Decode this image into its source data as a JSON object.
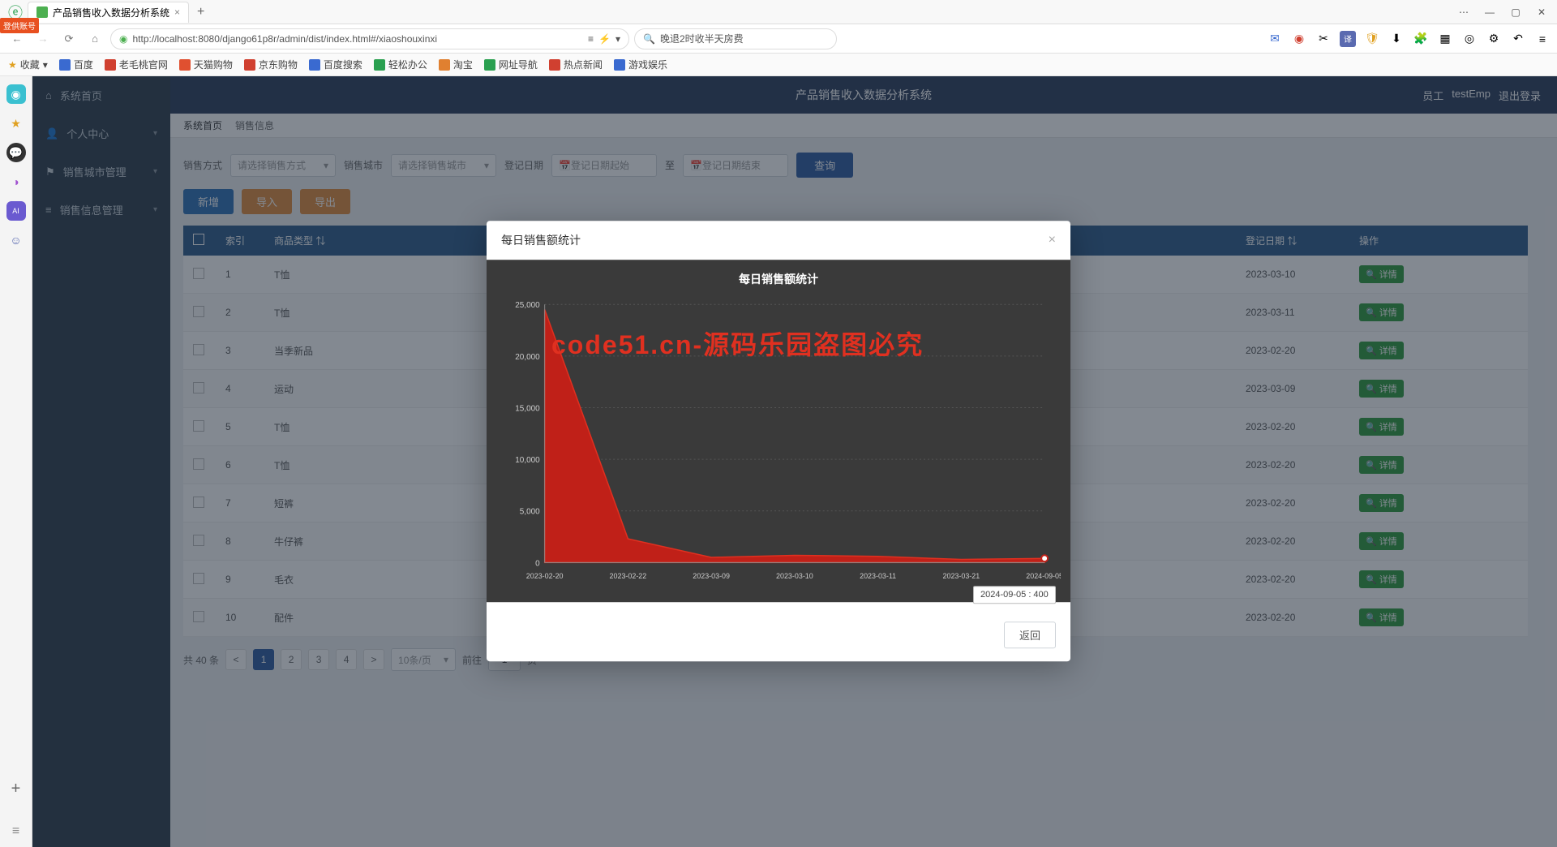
{
  "browser": {
    "tab_title": "产品销售收入数据分析系统",
    "url": "http://localhost:8080/django61p8r/admin/dist/index.html#/xiaoshouxinxi",
    "search_placeholder": "晚退2时收半天房费",
    "login_badge": "登供账号",
    "bookmarks": [
      "收藏",
      "百度",
      "老毛桃官网",
      "天猫购物",
      "京东购物",
      "百度搜索",
      "轻松办公",
      "淘宝",
      "网址导航",
      "热点新闻",
      "游戏娱乐"
    ]
  },
  "app": {
    "title": "产品销售收入数据分析系统",
    "user_role": "员工",
    "user_name": "testEmp",
    "logout": "退出登录",
    "menu": [
      "系统首页",
      "个人中心",
      "销售城市管理",
      "销售信息管理"
    ],
    "crumb_home": "系统首页",
    "crumb_page": "销售信息"
  },
  "filter": {
    "label_type": "销售方式",
    "ph_type": "请选择销售方式",
    "label_city": "销售城市",
    "ph_city": "请选择销售城市",
    "label_date": "登记日期",
    "ph_date_start": "登记日期起始",
    "to": "至",
    "ph_date_end": "登记日期结束",
    "btn_search": "查询"
  },
  "buttons": {
    "add": "新增",
    "import": "导入",
    "export": "导出"
  },
  "table": {
    "headers": [
      "",
      "索引",
      "商品类型",
      "",
      "登记日期",
      "操作"
    ],
    "detail": "详情",
    "rows": [
      {
        "idx": "1",
        "type": "T恤",
        "date": "2023-03-10"
      },
      {
        "idx": "2",
        "type": "T恤",
        "date": "2023-03-11"
      },
      {
        "idx": "3",
        "type": "当季新品",
        "date": "2023-02-20"
      },
      {
        "idx": "4",
        "type": "运动",
        "date": "2023-03-09"
      },
      {
        "idx": "5",
        "type": "T恤",
        "date": "2023-02-20"
      },
      {
        "idx": "6",
        "type": "T恤",
        "date": "2023-02-20"
      },
      {
        "idx": "7",
        "type": "短裤",
        "date": "2023-02-20"
      },
      {
        "idx": "8",
        "type": "牛仔裤",
        "date": "2023-02-20"
      },
      {
        "idx": "9",
        "type": "毛衣",
        "date": "2023-02-20"
      },
      {
        "idx": "10",
        "type": "配件",
        "date": "2023-02-20"
      }
    ]
  },
  "pager": {
    "total": "共 40 条",
    "prev": "<",
    "pages": [
      "1",
      "2",
      "3",
      "4"
    ],
    "next": ">",
    "size": "10条/页",
    "goto": "前往",
    "page_val": "1",
    "page_suffix": "页"
  },
  "modal": {
    "title": "每日销售额统计",
    "close": "×",
    "back": "返回",
    "tooltip": "2024-09-05 : 400"
  },
  "chart_data": {
    "type": "area",
    "title": "每日销售额统计",
    "x": [
      "2023-02-20",
      "2023-02-22",
      "2023-03-09",
      "2023-03-10",
      "2023-03-11",
      "2023-03-21",
      "2024-09-05"
    ],
    "values": [
      24500,
      2300,
      500,
      700,
      600,
      300,
      400
    ],
    "ylim": [
      0,
      25000
    ],
    "yticks": [
      0,
      5000,
      10000,
      15000,
      20000,
      25000
    ],
    "xlabel": "",
    "ylabel": ""
  },
  "watermark": "code51.cn",
  "watermark_red": "code51.cn-源码乐园盗图必究"
}
